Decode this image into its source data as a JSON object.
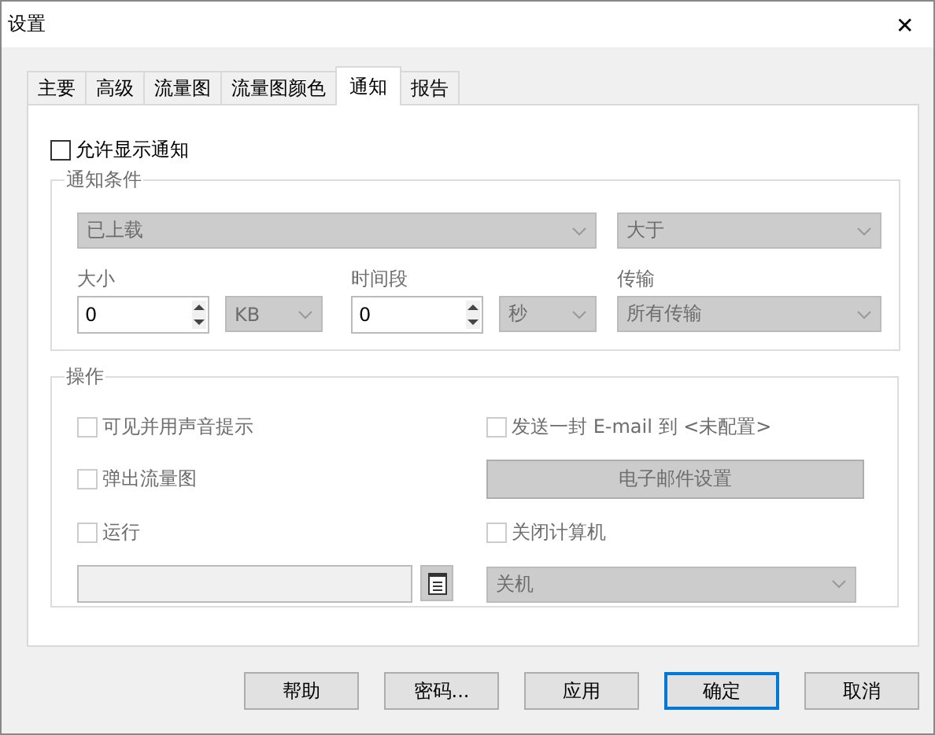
{
  "window": {
    "title": "设置",
    "close": "✕"
  },
  "tabs": [
    {
      "label": "主要",
      "selected": false
    },
    {
      "label": "高级",
      "selected": false
    },
    {
      "label": "流量图",
      "selected": false
    },
    {
      "label": "流量图颜色",
      "selected": false
    },
    {
      "label": "通知",
      "selected": true
    },
    {
      "label": "报告",
      "selected": false
    }
  ],
  "enable_notifications": {
    "label": "允许显示通知",
    "checked": false
  },
  "conditions": {
    "title": "通知条件",
    "direction": {
      "value": "已上载",
      "disabled": true
    },
    "comparison": {
      "value": "大于",
      "disabled": true
    },
    "size": {
      "label": "大小",
      "value": "0",
      "unit": "KB",
      "disabled": true
    },
    "period": {
      "label": "时间段",
      "value": "0",
      "unit": "秒",
      "disabled": true
    },
    "transfer": {
      "label": "传输",
      "value": "所有传输",
      "disabled": true
    }
  },
  "actions": {
    "title": "操作",
    "checkboxes": [
      {
        "label": "可见并用声音提示",
        "checked": false,
        "disabled": true
      },
      {
        "label": "发送一封 E-mail 到 <未配置>",
        "checked": false,
        "disabled": true
      },
      {
        "label": "弹出流量图",
        "checked": false,
        "disabled": true
      },
      {
        "kind": "button",
        "label": "电子邮件设置",
        "disabled": true
      },
      {
        "label": "运行",
        "checked": false,
        "disabled": true
      },
      {
        "label": "关闭计算机",
        "checked": false,
        "disabled": true
      }
    ],
    "run_path": {
      "disabled": true
    },
    "shutdown_mode": {
      "value": "关机",
      "disabled": true
    }
  },
  "buttons": [
    {
      "label": "帮助",
      "selected": false
    },
    {
      "label": "密码...",
      "selected": false
    },
    {
      "label": "应用",
      "selected": false
    },
    {
      "label": "确定",
      "selected": true
    },
    {
      "label": "取消",
      "selected": false
    }
  ]
}
